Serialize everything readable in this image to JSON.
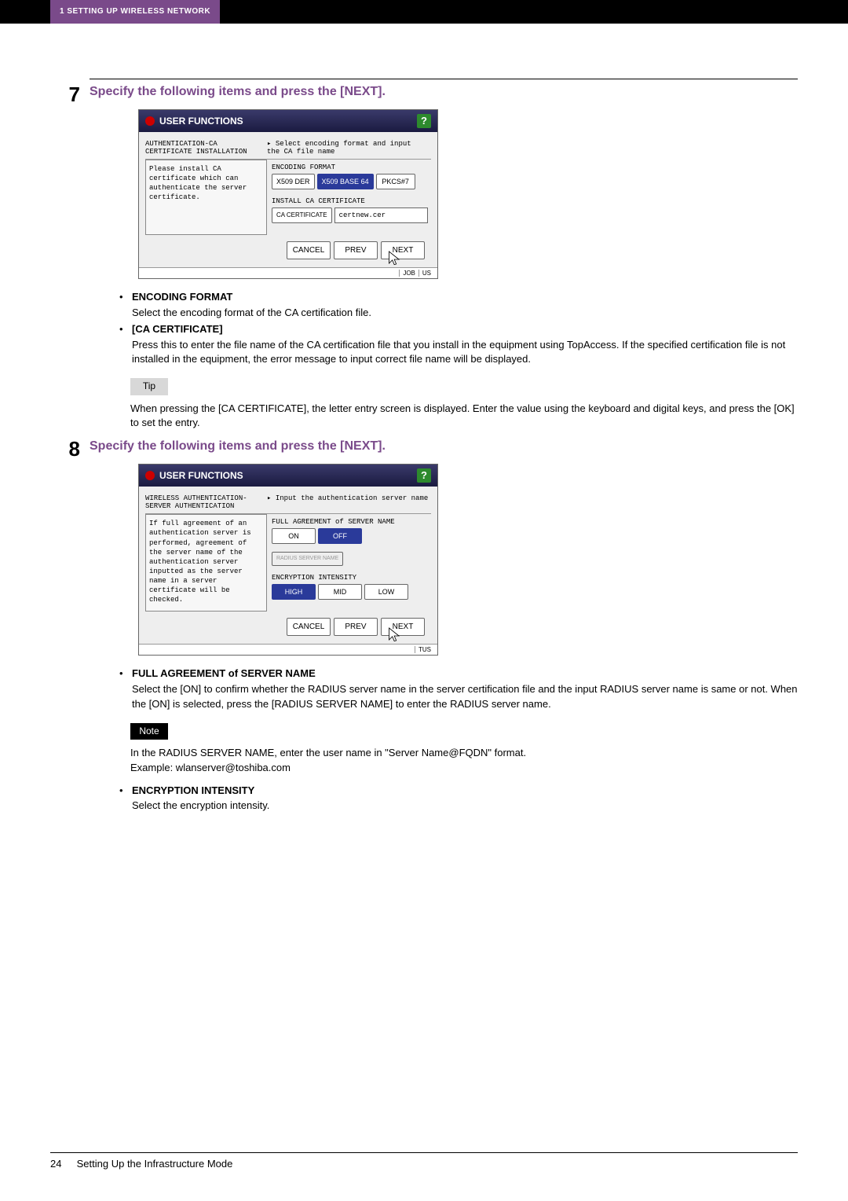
{
  "header": {
    "section_label": "1 SETTING UP WIRELESS NETWORK"
  },
  "step7": {
    "num": "7",
    "heading": "Specify the following items and press the [NEXT].",
    "shot": {
      "title": "USER FUNCTIONS",
      "heading_left_line1": "AUTHENTICATION-CA",
      "heading_left_line2": "CERTIFICATE INSTALLATION",
      "heading_right_line1": "▸ Select encoding format and input",
      "heading_right_line2": "the CA file name",
      "leftcol": "Please install CA certificate which can authenticate the server certificate.",
      "label_encoding": "ENCODING FORMAT",
      "encoding": {
        "x509der": "X509 DER",
        "x509b64": "X509 BASE 64",
        "pkcs7": "PKCS#7"
      },
      "label_install": "INSTALL CA CERTIFICATE",
      "cert_btn": "CA CERTIFICATE",
      "cert_value": "certnew.cer",
      "cancel": "CANCEL",
      "prev": "PREV",
      "next": "NEXT",
      "status_job": "JOB",
      "status_us": "US"
    },
    "bullets": {
      "enc_head": "ENCODING FORMAT",
      "enc_text": "Select the encoding format of the CA certification file.",
      "ca_head": "[CA CERTIFICATE]",
      "ca_text": "Press this to enter the file name of the CA certification file that you install in the equipment using TopAccess.  If the specified certification file is not installed in the equipment, the error message to input correct file name will be displayed."
    },
    "tip": {
      "label": "Tip",
      "text": "When pressing the [CA CERTIFICATE], the letter entry screen is displayed. Enter the value using the keyboard and digital keys, and press the [OK] to set the entry."
    }
  },
  "step8": {
    "num": "8",
    "heading": "Specify the following items and press the [NEXT].",
    "shot": {
      "title": "USER FUNCTIONS",
      "heading_left_line1": "WIRELESS AUTHENTICATION-",
      "heading_left_line2": "SERVER AUTHENTICATION",
      "heading_right_line1": "▸ Input the authentication server name",
      "leftcol": "If full agreement of an authentication server is performed, agreement of the server name of the authentication server inputted as the server name in a server certificate will be checked.",
      "label_full": "FULL AGREEMENT of SERVER NAME",
      "onoff": {
        "on": "ON",
        "off": "OFF"
      },
      "radius_btn": "RADIUS SERVER NAME",
      "label_enc": "ENCRYPTION INTENSITY",
      "intensity": {
        "high": "HIGH",
        "mid": "MID",
        "low": "LOW"
      },
      "cancel": "CANCEL",
      "prev": "PREV",
      "next": "NEXT",
      "status_tus": "TUS"
    },
    "bullets": {
      "full_head": "FULL AGREEMENT of SERVER NAME",
      "full_text": "Select the [ON] to confirm whether the RADIUS server name in the server certification file and the input RADIUS server name is same or not. When the [ON] is selected, press the [RADIUS SERVER NAME] to enter the RADIUS server name.",
      "enc_head": "ENCRYPTION INTENSITY",
      "enc_text": "Select the encryption intensity."
    },
    "note": {
      "label": "Note",
      "line1": "In the RADIUS SERVER NAME, enter the user name in \"Server Name@FQDN\" format.",
      "line2": "Example: wlanserver@toshiba.com"
    }
  },
  "footer": {
    "page": "24",
    "title": "Setting Up the Infrastructure Mode"
  }
}
